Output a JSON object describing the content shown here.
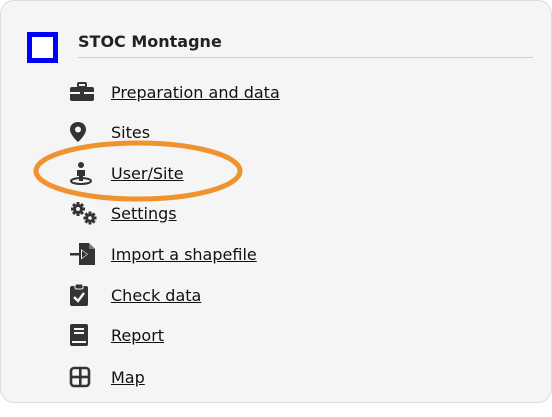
{
  "header": {
    "title": "STOC Montagne",
    "accent_color": "#0000ff"
  },
  "menu": {
    "items": [
      {
        "label": "Preparation and data",
        "icon": "toolbox-icon"
      },
      {
        "label": "Sites",
        "icon": "map-pin-icon"
      },
      {
        "label": "User/Site",
        "icon": "user-location-icon"
      },
      {
        "label": "Settings",
        "icon": "gears-icon"
      },
      {
        "label": "Import a shapefile",
        "icon": "file-import-icon"
      },
      {
        "label": "Check data",
        "icon": "clipboard-check-icon"
      },
      {
        "label": "Report",
        "icon": "book-icon"
      },
      {
        "label": "Map",
        "icon": "grid-map-icon"
      }
    ]
  },
  "annotation": {
    "highlight_color": "#f0922e",
    "highlighted_item": "User/Site"
  }
}
